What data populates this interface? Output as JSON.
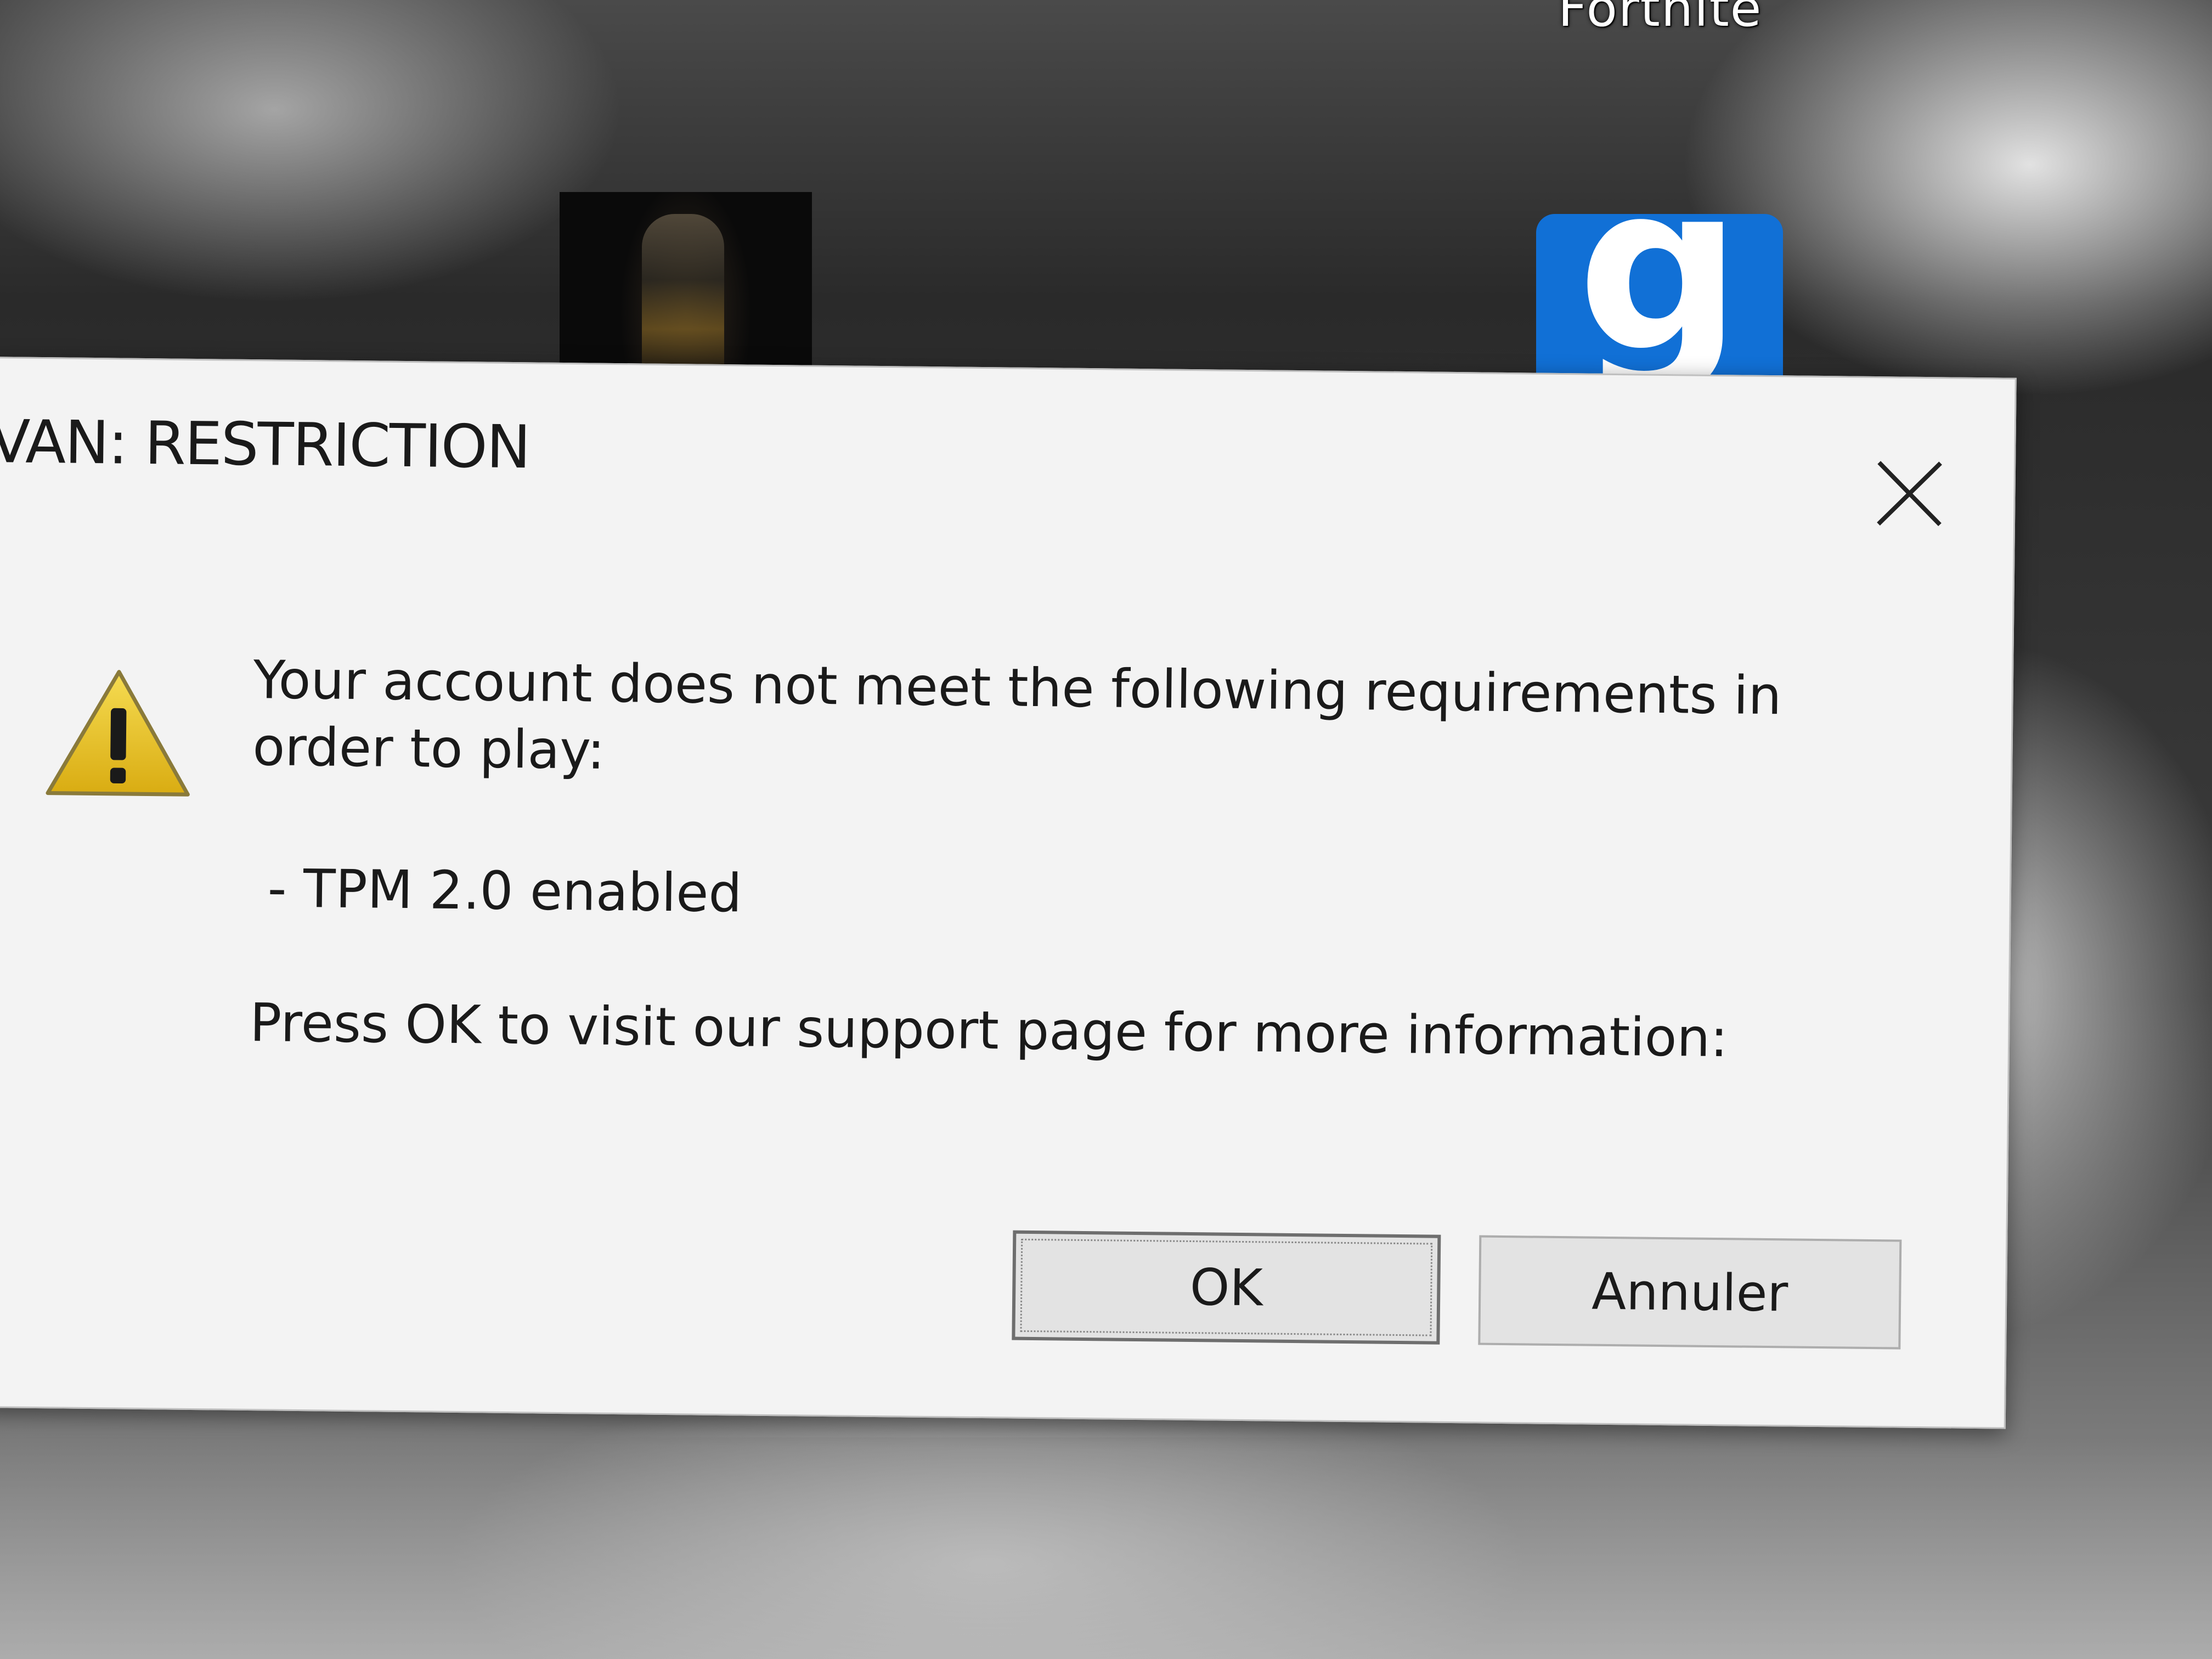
{
  "desktop": {
    "left_label": "",
    "fortnite_label": "Fortnite",
    "blue_icon_glyph": "g"
  },
  "dialog": {
    "title": "VAN: RESTRICTION",
    "close_icon": "close-icon",
    "warning_icon": "warning-icon",
    "message": "Your account does not meet the following requirements in order to play:",
    "requirement": "- TPM 2.0 enabled",
    "support_text": "Press OK to visit our support page for more information:",
    "ok_label": "OK",
    "cancel_label": "Annuler"
  },
  "colors": {
    "dialog_bg": "#f3f3f3",
    "warning_yellow": "#e8c21a",
    "icon_blue": "#1170d6"
  }
}
